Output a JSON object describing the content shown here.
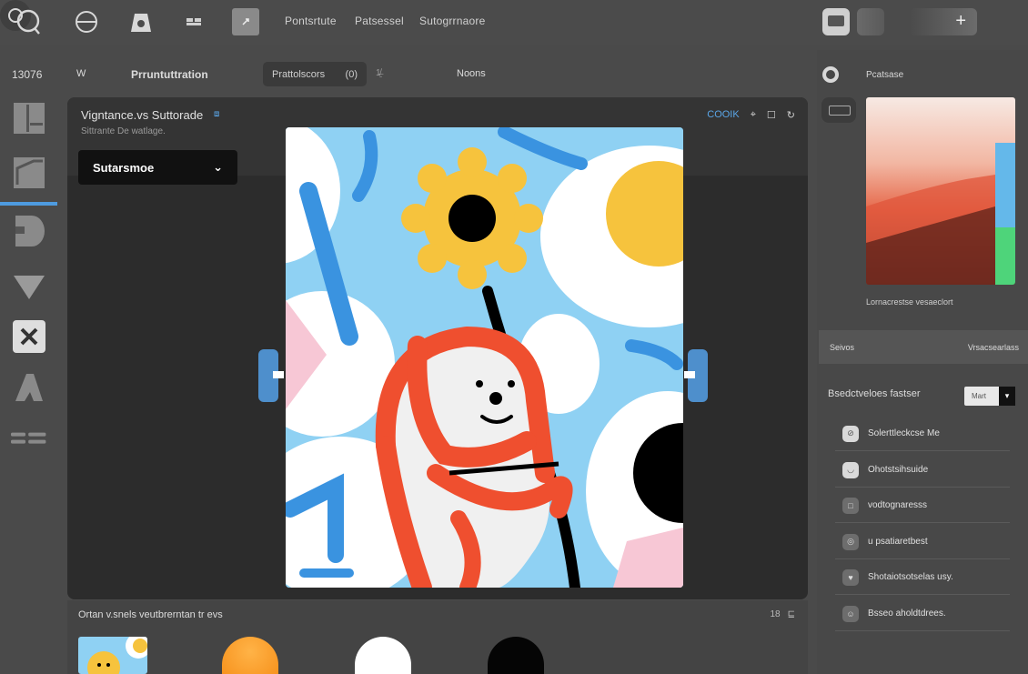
{
  "topbar": {
    "menu": [
      "Pontsrtute",
      "Patsessel",
      "Sutogrrnaore"
    ]
  },
  "subbar": {
    "doc_id": "13076",
    "mode": "W",
    "doc_title": "Prruntuttration",
    "zoom_field": {
      "label": "Prattolscors",
      "value": "(0)"
    },
    "group_value": "1̸̶̱",
    "status": "Noons"
  },
  "canvas": {
    "title": "Vigntance.vs Suttorade",
    "subtitle": "Sittrante De watlage.",
    "dropdown": "Sutarsmoe",
    "link": "COOIK"
  },
  "bottom": {
    "label": "Ortan v.snels veutbrerntan tr evs",
    "count": "18"
  },
  "right_panel": {
    "header": "Pcatsase",
    "picker_label": "Lornacrestse vesaeclort",
    "section_left": "Seivos",
    "section_right": "Vrsacsearlass",
    "option_label": "Bsedctveloes fastser",
    "option_value": "Mart",
    "items": [
      {
        "label": "Solerttleckcse Me",
        "icon": "⊘"
      },
      {
        "label": "Ohotstsihsuide",
        "icon": "◡"
      },
      {
        "label": "vodtognaresss",
        "icon": "□"
      },
      {
        "label": "u psatiaretbest",
        "icon": "◎"
      },
      {
        "label": "Shotaiotsotselas usy.",
        "icon": "♥"
      },
      {
        "label": "Bsseo aholdtdrees.",
        "icon": "☺"
      }
    ]
  },
  "colors": {
    "accent": "#5aa6e8",
    "artwork_sky": "#8fd1f3",
    "artwork_red": "#ef4f2f",
    "artwork_yellow": "#f6c33d"
  }
}
